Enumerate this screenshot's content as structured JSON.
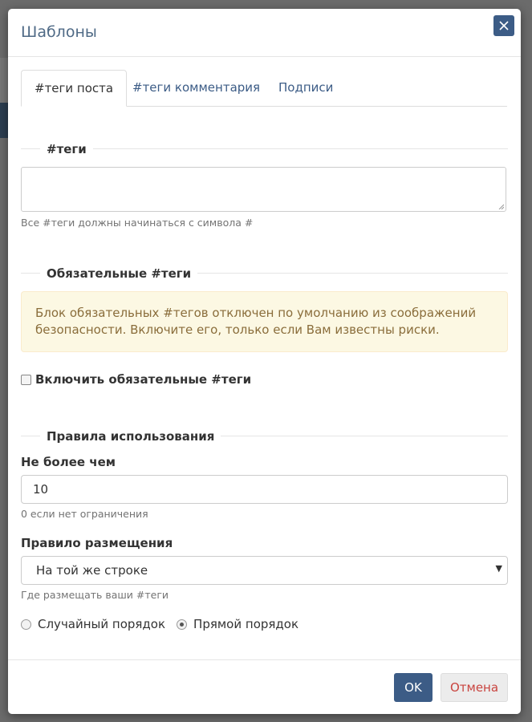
{
  "modal": {
    "title": "Шаблоны",
    "close_icon": "close-icon"
  },
  "tabs": [
    {
      "label": "#теги поста",
      "active": true
    },
    {
      "label": "#теги комментария",
      "active": false
    },
    {
      "label": "Подписи",
      "active": false
    }
  ],
  "tags_section": {
    "legend": "#теги",
    "textarea_value": "",
    "help": "Все #теги должны начинаться с символа #"
  },
  "required_section": {
    "legend": "Обязательные #теги",
    "alert": "Блок обязательных #тегов отключен по умолчанию из соображений безопасности. Включите его, только если Вам известны риски.",
    "checkbox_label": "Включить обязательные #теги",
    "checkbox_checked": false
  },
  "usage_section": {
    "legend": "Правила использования",
    "max_label": "Не более чем",
    "max_value": "10",
    "max_help": "0 если нет ограничения",
    "placement_label": "Правило размещения",
    "placement_value": "На той же строке",
    "placement_help": "Где размещать ваши #теги",
    "order_options": [
      {
        "label": "Случайный порядок",
        "checked": false
      },
      {
        "label": "Прямой порядок",
        "checked": true
      }
    ]
  },
  "footer": {
    "ok_label": "OK",
    "cancel_label": "Отмена"
  },
  "colors": {
    "primary": "#3c5c86",
    "cancel_text": "#c9443f",
    "alert_bg": "#fcf8e3",
    "alert_text": "#8a6d3b"
  }
}
